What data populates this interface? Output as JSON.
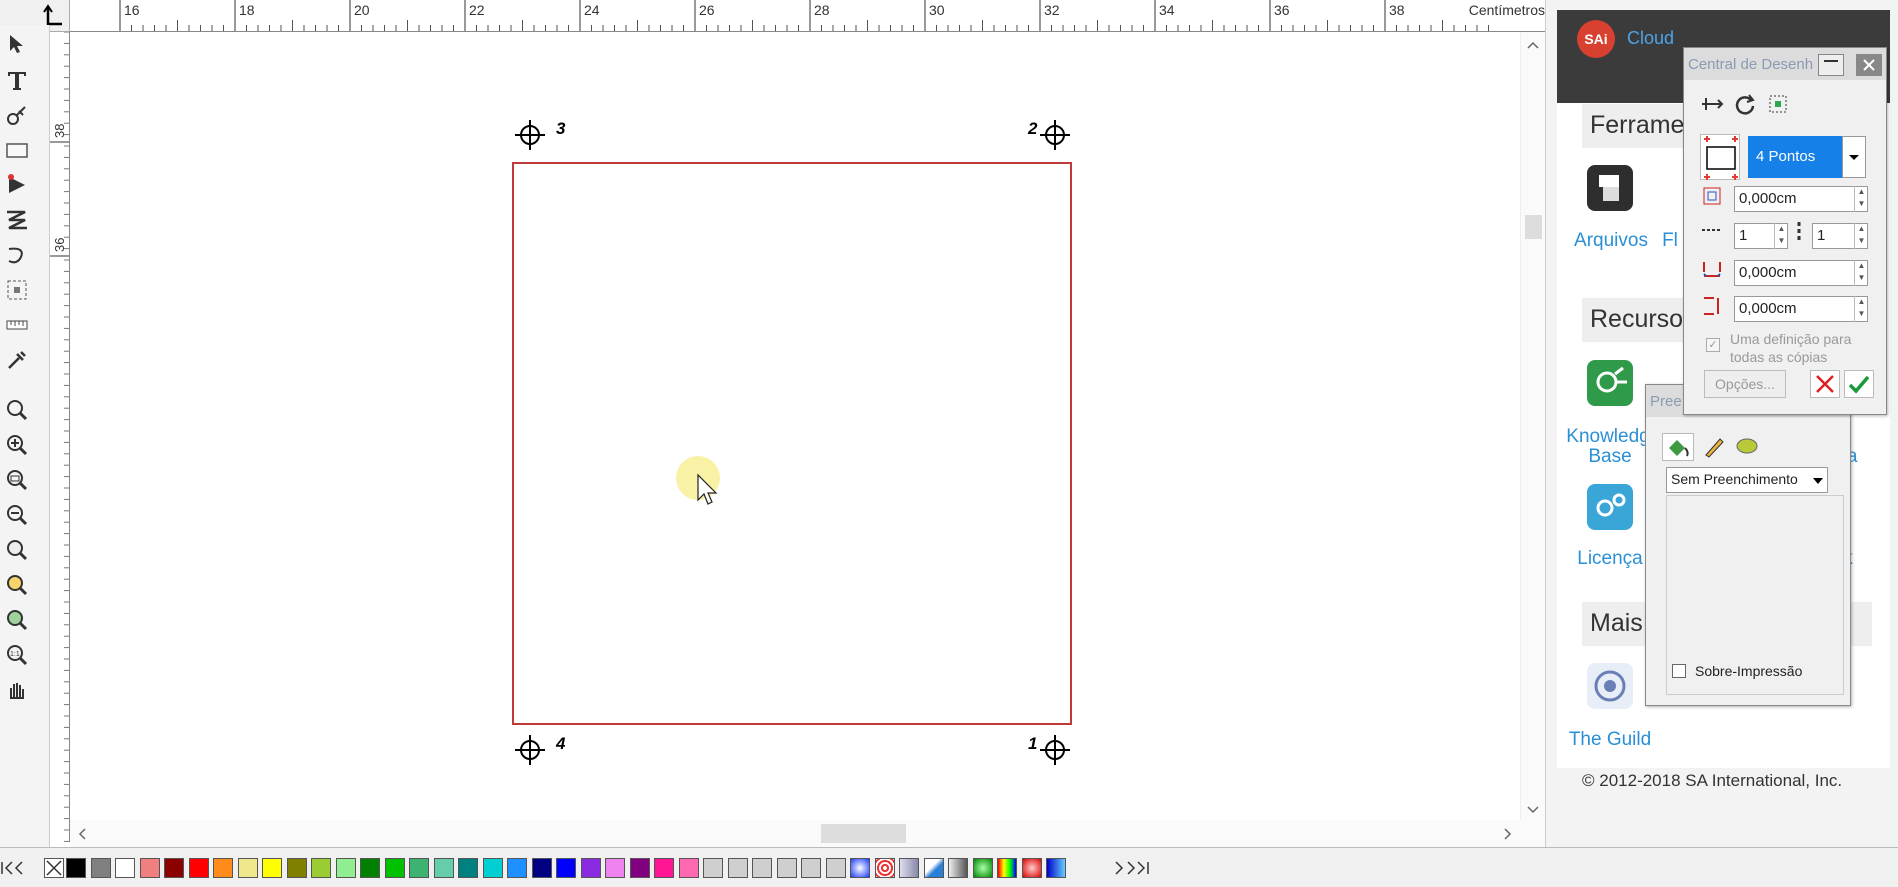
{
  "ruler": {
    "unit_label": "Centímetros",
    "top_ticks": [
      "16",
      "18",
      "20",
      "22",
      "24",
      "26",
      "28",
      "30",
      "32",
      "34",
      "36",
      "38"
    ],
    "left_ticks": [
      "38",
      "36"
    ]
  },
  "toolbar": {
    "tools": [
      "select-tool",
      "text-tool",
      "pen-tool",
      "rectangle-tool",
      "node-edit-tool",
      "zigzag-tool",
      "curve-tool",
      "selection-box-tool",
      "measure-tool",
      "eyedropper-tool",
      "zoom-tool",
      "zoom-in-tool",
      "zoom-area-tool",
      "zoom-out-tool",
      "zoom-all-tool",
      "zoom-selected-tool",
      "zoom-page-tool",
      "zoom-1to1-tool",
      "pan-tool"
    ]
  },
  "canvas": {
    "marks": [
      {
        "label": "3"
      },
      {
        "label": "2"
      },
      {
        "label": "4"
      },
      {
        "label": "1"
      }
    ]
  },
  "palette": {
    "colors": [
      "#000000",
      "#808080",
      "#ffffff",
      "#f08080",
      "#8b0000",
      "#ff0000",
      "#ff8c1a",
      "#f0e68c",
      "#ffff00",
      "#808000",
      "#9acd32",
      "#90ee90",
      "#008000",
      "#00c000",
      "#3cb371",
      "#66cdaa",
      "#008080",
      "#00ced1",
      "#1e90ff",
      "#000080",
      "#0000ff",
      "#8a2be2",
      "#ee82ee",
      "#800080",
      "#ff1493",
      "#ff69b4"
    ]
  },
  "cloud_panel": {
    "brand": "SAi",
    "cloud_label": "Cloud",
    "sections": {
      "tools_title": "Ferrame",
      "resources_title": "Recurso",
      "more_title": "Mais"
    },
    "links": {
      "files": "Arquivos",
      "files_partial": "Fl",
      "knowledge_line1": "Knowledg",
      "knowledge_line2": "Base",
      "licenses": "Licença",
      "guild": "The Guild",
      "partial_ra": "ra",
      "partial_k": "k"
    },
    "copyright": "© 2012-2018 SA International, Inc."
  },
  "drawing_center": {
    "title": "Central de Desenh",
    "mode_value": "4 Pontos",
    "offset_value": "0,000cm",
    "count_left": "1",
    "count_right": "1",
    "gap_h_value": "0,000cm",
    "gap_v_value": "0,000cm",
    "checkbox_label_line1": "Uma definição para",
    "checkbox_label_line2": "todas as cópias",
    "options_button": "Opções..."
  },
  "fill_dialog": {
    "title": "Pree",
    "fill_value": "Sem Preenchimento",
    "overprint_label": "Sobre-Impressão"
  }
}
